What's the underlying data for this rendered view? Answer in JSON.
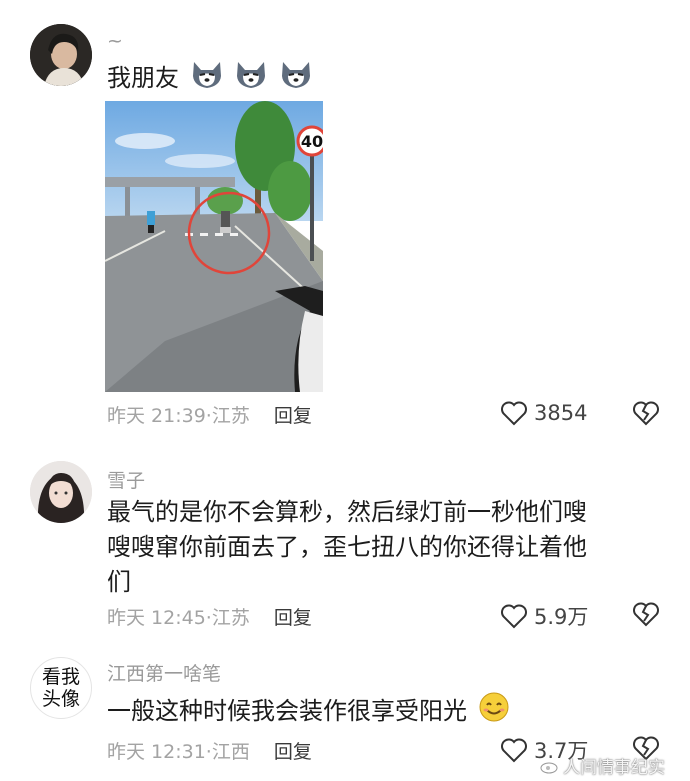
{
  "comments": [
    {
      "username": "~",
      "text": "我朋友",
      "emoji_count": 3,
      "emoji_icon": "husky-dog-emoji",
      "time": "昨天 21:39",
      "location": "江苏",
      "reply": "回复",
      "likes": "3854"
    },
    {
      "username": "雪子",
      "text_lines": [
        "最气的是你不会算秒，然后绿灯前一秒他们嗖",
        "嗖嗖窜你前面去了，歪七扭八的你还得让着他",
        "们"
      ],
      "time": "昨天 12:45",
      "location": "江苏",
      "reply": "回复",
      "likes": "5.9万"
    },
    {
      "username": "江西第一啥笔",
      "avatar_text_line1": "看我",
      "avatar_text_line2": "头像",
      "text": "一般这种时候我会装作很享受阳光",
      "emoji_icon": "smiling-face-emoji",
      "time": "昨天 12:31",
      "location": "江西",
      "reply": "回复",
      "likes": "3.7万"
    }
  ],
  "photo": {
    "speed_sign": "40"
  },
  "watermark": "人间情事纪实",
  "colors": {
    "meta": "#a3a3a3",
    "username": "#9a9a9a",
    "sky": "#7fb3e6",
    "circle": "#e0453a"
  }
}
